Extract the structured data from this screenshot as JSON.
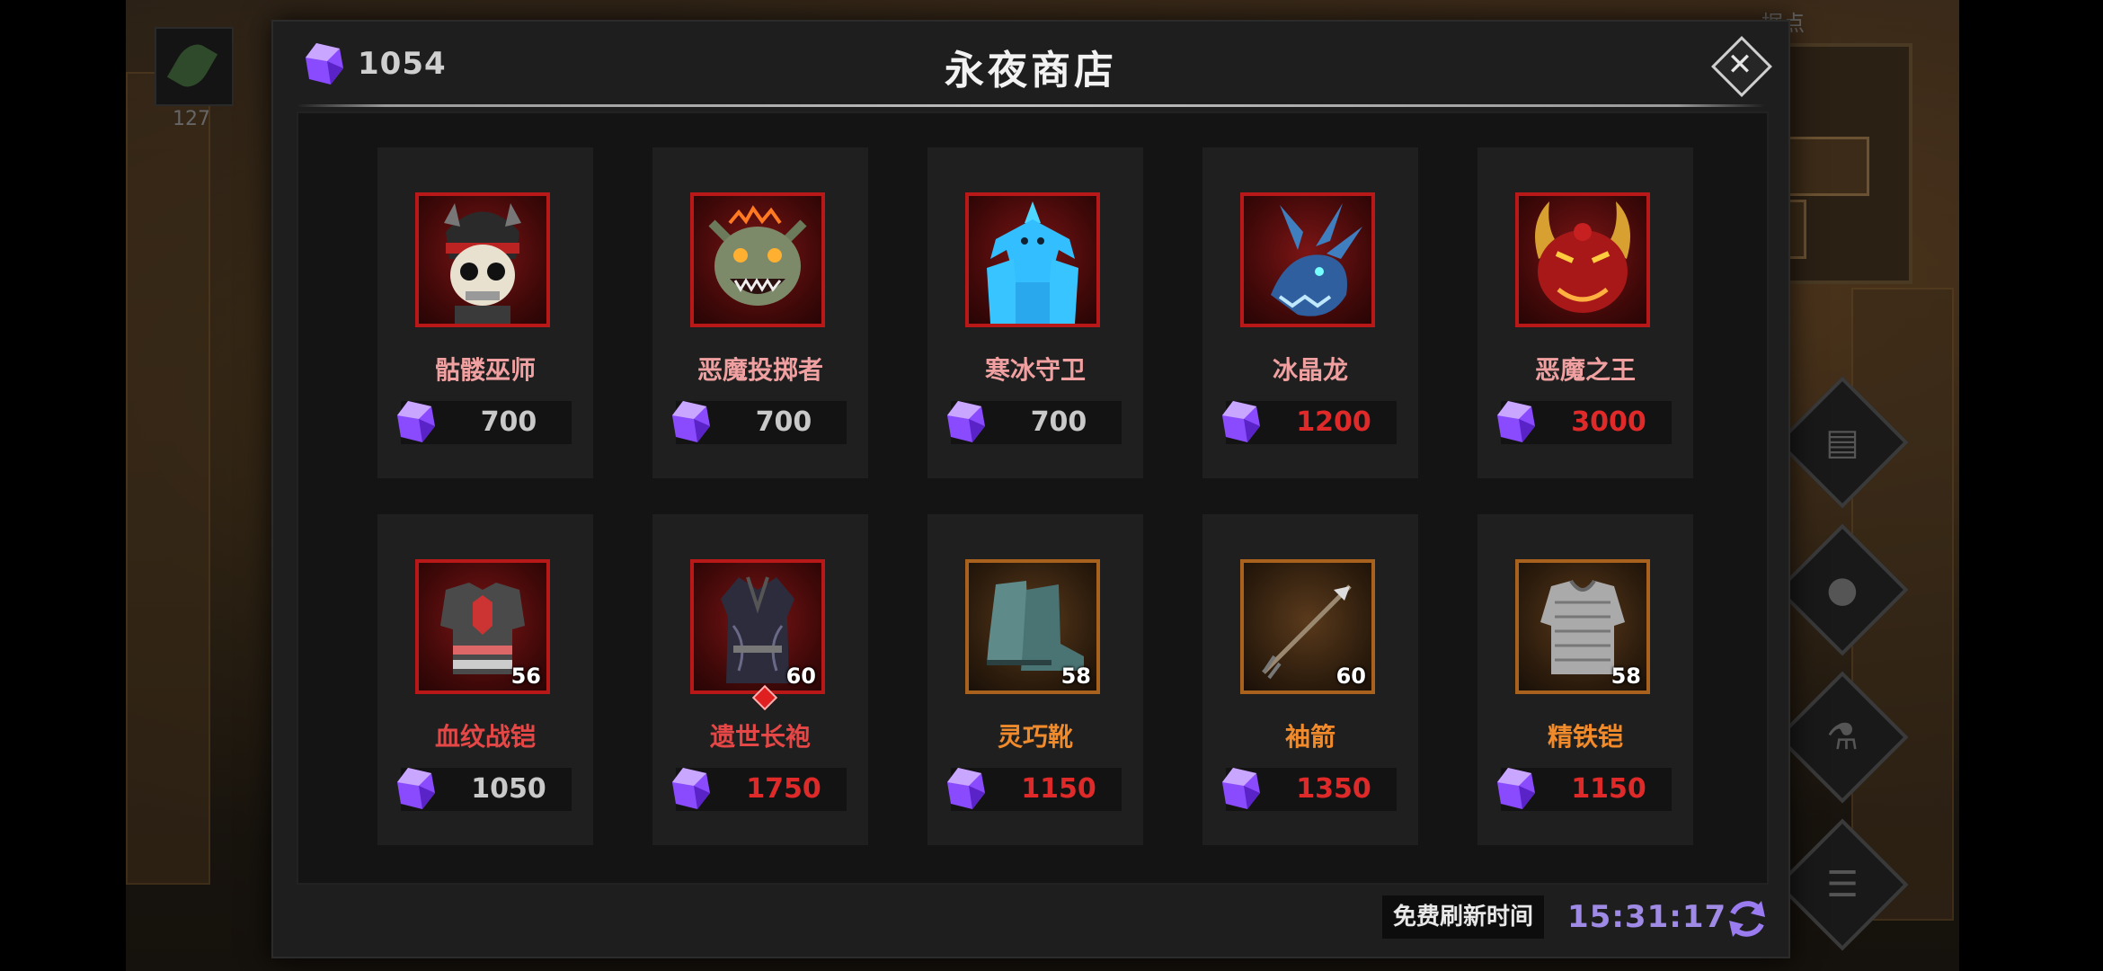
{
  "background": {
    "item_count": "127",
    "minimap_label": "据点",
    "side_buttons": [
      {
        "icon": "scroll-icon"
      },
      {
        "icon": "people-icon"
      },
      {
        "icon": "potion-icon"
      },
      {
        "icon": "list-icon"
      }
    ]
  },
  "shop": {
    "title": "永夜商店",
    "currency_amount": "1054",
    "close_icon": "close-icon",
    "refresh_label": "免费刷新时间",
    "refresh_timer": "15:31:17",
    "refresh_icon": "refresh-icon",
    "colors": {
      "gem": "#8a4bff",
      "price_red": "#e02a2a",
      "timer": "#9f8ae6",
      "frame_red": "#b81818",
      "frame_bronze": "#a8621e"
    },
    "items": [
      {
        "name": "骷髅巫师",
        "price": "700",
        "icon": "skeleton-wizard-icon"
      },
      {
        "name": "恶魔投掷者",
        "price": "700",
        "icon": "demon-thrower-icon"
      },
      {
        "name": "寒冰守卫",
        "price": "700",
        "icon": "ice-guard-icon"
      },
      {
        "name": "冰晶龙",
        "price": "1200",
        "icon": "ice-dragon-icon"
      },
      {
        "name": "恶魔之王",
        "price": "3000",
        "icon": "demon-king-icon"
      },
      {
        "name": "血纹战铠",
        "price": "1050",
        "level": "56",
        "icon": "chest-armor-icon"
      },
      {
        "name": "遗世长袍",
        "price": "1750",
        "level": "60",
        "icon": "robe-icon"
      },
      {
        "name": "灵巧靴",
        "price": "1150",
        "level": "58",
        "icon": "boots-icon"
      },
      {
        "name": "袖箭",
        "price": "1350",
        "level": "60",
        "icon": "sleeve-arrow-icon"
      },
      {
        "name": "精铁铠",
        "price": "1150",
        "level": "58",
        "icon": "chainmail-icon"
      }
    ]
  }
}
